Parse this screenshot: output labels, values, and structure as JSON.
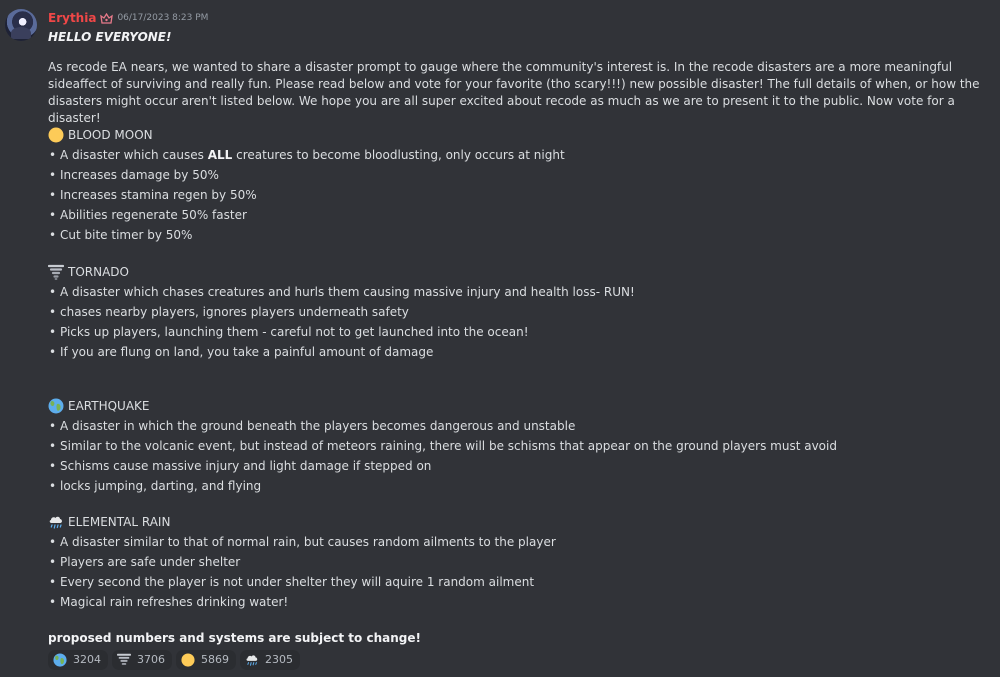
{
  "author": {
    "username": "Erythia",
    "timestamp": "06/17/2023 8:23 PM",
    "avatar_icon": "anime-avatar",
    "role_icon": "role-badge-icon",
    "username_color": "#f04747"
  },
  "message": {
    "greeting": "HELLO EVERYONE!",
    "intro": "As recode EA nears, we wanted to share a disaster prompt to gauge where the community's interest is. In the recode disasters are a more meaningful sideaffect of surviving and really fun. Please read below and vote for your favorite (tho scary!!!) new possible disaster! The full details of when, or how the disasters might occur aren't listed below. We hope you are all super excited about recode as much as we are to present it to the public. Now vote for a disaster!",
    "sections": [
      {
        "title": "BLOOD MOON",
        "emoji": "yellow-circle-icon",
        "items": [
          {
            "pre": "A disaster which causes ",
            "bold": "ALL",
            "post": " creatures to become bloodlusting, only occurs at night"
          },
          {
            "pre": "Increases damage by 50%",
            "bold": "",
            "post": ""
          },
          {
            "pre": "Increases stamina regen by 50%",
            "bold": "",
            "post": ""
          },
          {
            "pre": "Abilities regenerate 50% faster",
            "bold": "",
            "post": ""
          },
          {
            "pre": "Cut bite timer by 50%",
            "bold": "",
            "post": ""
          }
        ]
      },
      {
        "title": "TORNADO",
        "emoji": "tornado-icon",
        "items": [
          {
            "pre": "A disaster which chases creatures and hurls them causing massive injury and health loss- RUN!",
            "bold": "",
            "post": ""
          },
          {
            "pre": "chases nearby players, ignores players underneath safety",
            "bold": "",
            "post": ""
          },
          {
            "pre": "Picks up players, launching them - careful not to get launched into the ocean!",
            "bold": "",
            "post": ""
          },
          {
            "pre": "If you are flung on land, you take a painful amount of damage",
            "bold": "",
            "post": ""
          }
        ]
      },
      {
        "title": "EARTHQUAKE",
        "emoji": "globe-icon",
        "items": [
          {
            "pre": "A disaster in which the ground beneath the players becomes dangerous and unstable",
            "bold": "",
            "post": ""
          },
          {
            "pre": "Similar to the volcanic event, but instead of meteors raining, there will be schisms that appear on the ground players must avoid",
            "bold": "",
            "post": ""
          },
          {
            "pre": "Schisms cause massive injury and light damage if stepped on",
            "bold": "",
            "post": ""
          },
          {
            "pre": "locks jumping, darting, and flying",
            "bold": "",
            "post": ""
          }
        ]
      },
      {
        "title": "ELEMENTAL RAIN",
        "emoji": "rain-cloud-icon",
        "items": [
          {
            "pre": "A disaster similar to that of normal rain, but causes random ailments to the player",
            "bold": "",
            "post": ""
          },
          {
            "pre": "Players are safe under shelter",
            "bold": "",
            "post": ""
          },
          {
            "pre": "Every second the player is not under shelter they will aquire 1 random ailment",
            "bold": "",
            "post": ""
          },
          {
            "pre": "Magical rain refreshes drinking water!",
            "bold": "",
            "post": ""
          }
        ]
      }
    ],
    "footer": "proposed numbers and systems are subject to change!"
  },
  "reactions": [
    {
      "emoji": "globe-icon",
      "count": "3204"
    },
    {
      "emoji": "tornado-icon",
      "count": "3706"
    },
    {
      "emoji": "yellow-circle-icon",
      "count": "5869"
    },
    {
      "emoji": "rain-cloud-icon",
      "count": "2305"
    }
  ]
}
